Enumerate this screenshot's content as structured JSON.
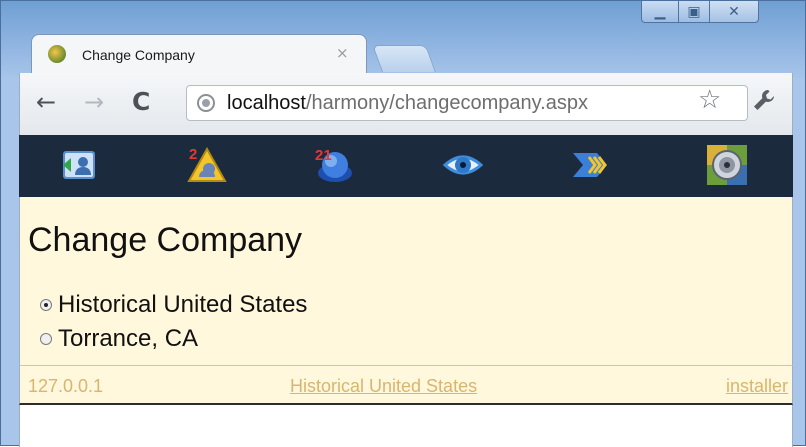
{
  "window": {
    "controls": {
      "minimize": "minimize-icon",
      "maximize": "maximize-icon",
      "close": "close-icon"
    }
  },
  "tab": {
    "title": "Change Company",
    "close_glyph": "×"
  },
  "toolbar": {
    "back_glyph": "←",
    "forward_glyph": "→",
    "reload_glyph": "C",
    "url_host": "localhost",
    "url_path": "/harmony/changecompany.aspx",
    "star_glyph": "☆",
    "wrench_glyph": "🔧"
  },
  "iconbar": {
    "icons": [
      "contacts-icon",
      "alert-icon",
      "calendar-icon",
      "eye-icon",
      "forward-arrows-icon",
      "target-icon"
    ],
    "background": "#1c2a3e"
  },
  "main": {
    "title": "Change Company",
    "options": [
      {
        "label": "Historical United States",
        "checked": true
      },
      {
        "label": "Torrance, CA",
        "checked": false
      }
    ],
    "background": "#fff8dc"
  },
  "footer": {
    "ip": "127.0.0.1",
    "company": "Historical United States",
    "user": "installer",
    "link_color": "#d8b570"
  }
}
